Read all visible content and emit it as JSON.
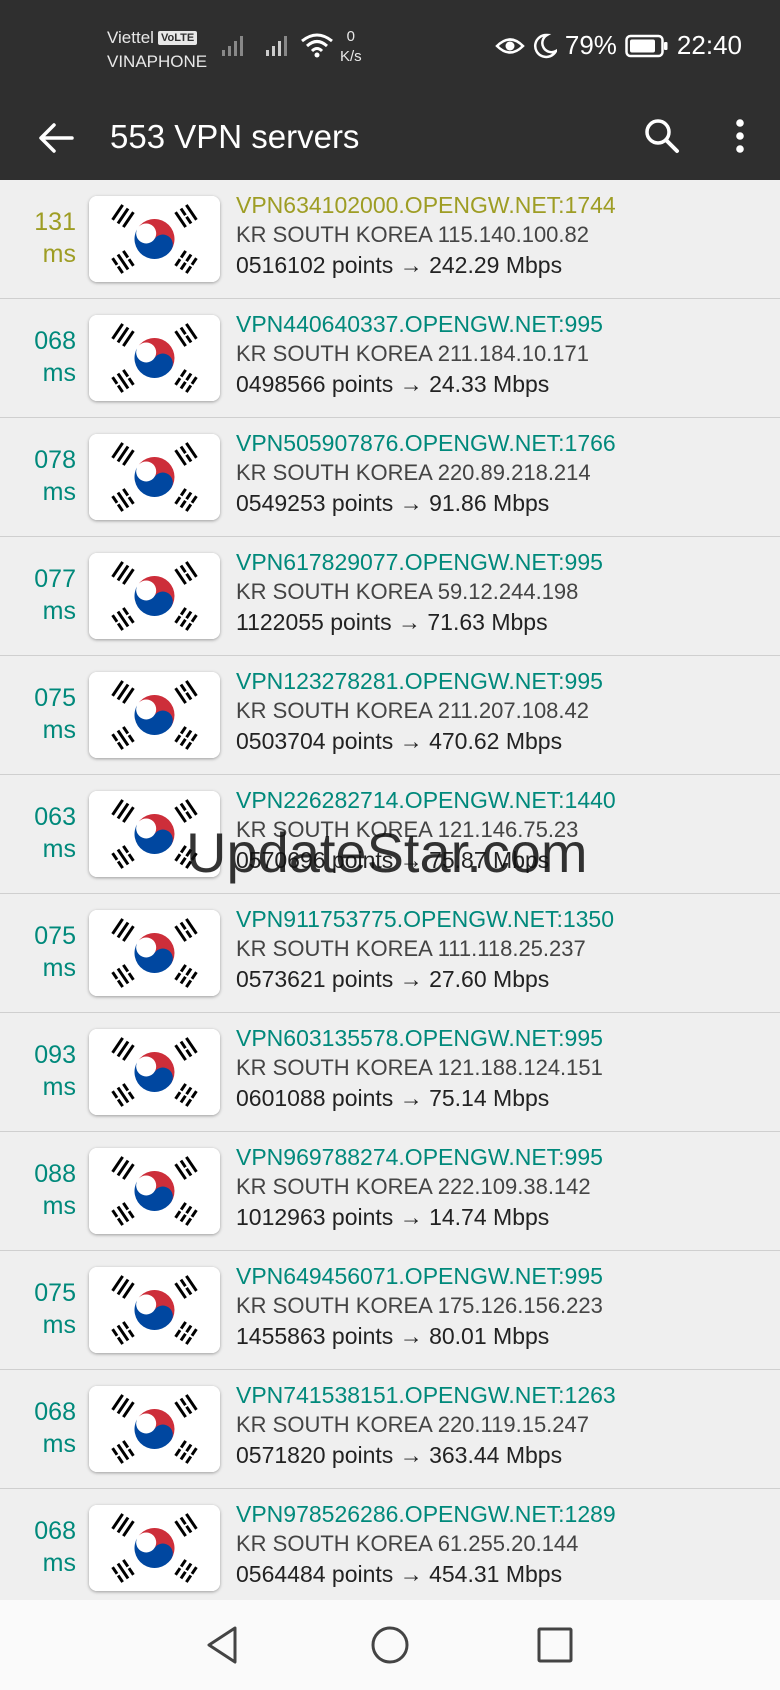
{
  "status": {
    "carrier1": "Viettel",
    "volte": "VoLTE",
    "carrier2": "VINAPHONE",
    "speed_value": "0",
    "speed_unit": "K/s",
    "battery": "79%",
    "time": "22:40"
  },
  "appbar": {
    "title": "553 VPN servers"
  },
  "servers": [
    {
      "ping": "131",
      "unit": "ms",
      "host": "VPN634102000.OPENGW.NET:1744",
      "location": "KR SOUTH KOREA 115.140.100.82",
      "stats": "0516102 points → 242.29 Mbps",
      "slow": true
    },
    {
      "ping": "068",
      "unit": "ms",
      "host": "VPN440640337.OPENGW.NET:995",
      "location": "KR SOUTH KOREA 211.184.10.171",
      "stats": "0498566 points → 24.33 Mbps",
      "slow": false
    },
    {
      "ping": "078",
      "unit": "ms",
      "host": "VPN505907876.OPENGW.NET:1766",
      "location": "KR SOUTH KOREA 220.89.218.214",
      "stats": "0549253 points → 91.86 Mbps",
      "slow": false
    },
    {
      "ping": "077",
      "unit": "ms",
      "host": "VPN617829077.OPENGW.NET:995",
      "location": "KR SOUTH KOREA 59.12.244.198",
      "stats": "1122055 points → 71.63 Mbps",
      "slow": false
    },
    {
      "ping": "075",
      "unit": "ms",
      "host": "VPN123278281.OPENGW.NET:995",
      "location": "KR SOUTH KOREA 211.207.108.42",
      "stats": "0503704 points → 470.62 Mbps",
      "slow": false
    },
    {
      "ping": "063",
      "unit": "ms",
      "host": "VPN226282714.OPENGW.NET:1440",
      "location": "KR SOUTH KOREA 121.146.75.23",
      "stats": "0570696 points → 75.87 Mbps",
      "slow": false
    },
    {
      "ping": "075",
      "unit": "ms",
      "host": "VPN911753775.OPENGW.NET:1350",
      "location": "KR SOUTH KOREA 111.118.25.237",
      "stats": "0573621 points → 27.60 Mbps",
      "slow": false
    },
    {
      "ping": "093",
      "unit": "ms",
      "host": "VPN603135578.OPENGW.NET:995",
      "location": "KR SOUTH KOREA 121.188.124.151",
      "stats": "0601088 points → 75.14 Mbps",
      "slow": false
    },
    {
      "ping": "088",
      "unit": "ms",
      "host": "VPN969788274.OPENGW.NET:995",
      "location": "KR SOUTH KOREA 222.109.38.142",
      "stats": "1012963 points → 14.74 Mbps",
      "slow": false
    },
    {
      "ping": "075",
      "unit": "ms",
      "host": "VPN649456071.OPENGW.NET:995",
      "location": "KR SOUTH KOREA 175.126.156.223",
      "stats": "1455863 points → 80.01 Mbps",
      "slow": false
    },
    {
      "ping": "068",
      "unit": "ms",
      "host": "VPN741538151.OPENGW.NET:1263",
      "location": "KR SOUTH KOREA 220.119.15.247",
      "stats": "0571820 points → 363.44 Mbps",
      "slow": false
    },
    {
      "ping": "068",
      "unit": "ms",
      "host": "VPN978526286.OPENGW.NET:1289",
      "location": "KR SOUTH KOREA 61.255.20.144",
      "stats": "0564484 points → 454.31 Mbps",
      "slow": false
    }
  ],
  "watermark": "UpdateStar.com",
  "colors": {
    "fast": "#00897b",
    "slow": "#9e9d24",
    "bar": "#2f2f2f"
  },
  "icons": {
    "back": "arrow-back-icon",
    "search": "search-icon",
    "more": "more-vert-icon",
    "flag": "south-korea-flag-icon"
  }
}
